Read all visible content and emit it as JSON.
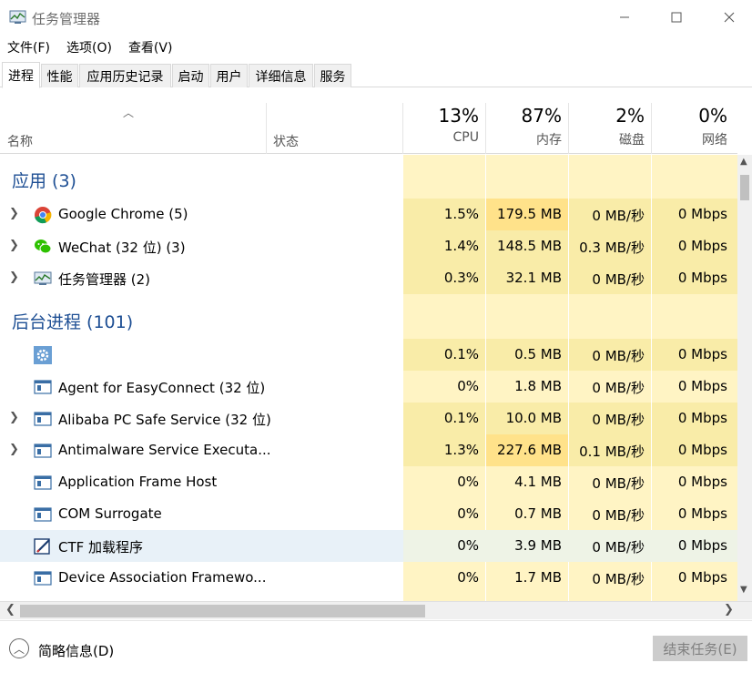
{
  "window": {
    "title": "任务管理器"
  },
  "menu": [
    "文件(F)",
    "选项(O)",
    "查看(V)"
  ],
  "tabs": [
    "进程",
    "性能",
    "应用历史记录",
    "启动",
    "用户",
    "详细信息",
    "服务"
  ],
  "columns": {
    "name": "名称",
    "status": "状态",
    "cpu": {
      "pct": "13%",
      "label": "CPU"
    },
    "memory": {
      "pct": "87%",
      "label": "内存"
    },
    "disk": {
      "pct": "2%",
      "label": "磁盘"
    },
    "network": {
      "pct": "0%",
      "label": "网络"
    }
  },
  "groups": {
    "apps": "应用 (3)",
    "background": "后台进程 (101)"
  },
  "apps": [
    {
      "name": "Google Chrome (5)",
      "icon": "chrome-icon",
      "cpu": "1.5%",
      "mem": "179.5 MB",
      "disk": "0 MB/秒",
      "net": "0 Mbps",
      "expandable": true
    },
    {
      "name": "WeChat (32 位) (3)",
      "icon": "wechat-icon",
      "cpu": "1.4%",
      "mem": "148.5 MB",
      "disk": "0.3 MB/秒",
      "net": "0 Mbps",
      "expandable": true
    },
    {
      "name": "任务管理器 (2)",
      "icon": "task-manager-icon",
      "cpu": "0.3%",
      "mem": "32.1 MB",
      "disk": "0 MB/秒",
      "net": "0 Mbps",
      "expandable": true
    }
  ],
  "background": [
    {
      "name": "",
      "icon": "gear-icon",
      "cpu": "0.1%",
      "mem": "0.5 MB",
      "disk": "0 MB/秒",
      "net": "0 Mbps",
      "expandable": false
    },
    {
      "name": "Agent for EasyConnect (32 位)",
      "icon": "window-icon",
      "cpu": "0%",
      "mem": "1.8 MB",
      "disk": "0 MB/秒",
      "net": "0 Mbps",
      "expandable": false
    },
    {
      "name": "Alibaba PC Safe Service (32 位)",
      "icon": "window-icon",
      "cpu": "0.1%",
      "mem": "10.0 MB",
      "disk": "0 MB/秒",
      "net": "0 Mbps",
      "expandable": true
    },
    {
      "name": "Antimalware Service Executa...",
      "icon": "window-icon",
      "cpu": "1.3%",
      "mem": "227.6 MB",
      "disk": "0.1 MB/秒",
      "net": "0 Mbps",
      "expandable": true
    },
    {
      "name": "Application Frame Host",
      "icon": "window-icon",
      "cpu": "0%",
      "mem": "4.1 MB",
      "disk": "0 MB/秒",
      "net": "0 Mbps",
      "expandable": false
    },
    {
      "name": "COM Surrogate",
      "icon": "window-icon",
      "cpu": "0%",
      "mem": "0.7 MB",
      "disk": "0 MB/秒",
      "net": "0 Mbps",
      "expandable": false
    },
    {
      "name": "CTF 加载程序",
      "icon": "ctf-pen-icon",
      "cpu": "0%",
      "mem": "3.9 MB",
      "disk": "0 MB/秒",
      "net": "0 Mbps",
      "expandable": false,
      "selected": true
    },
    {
      "name": "Device Association Framewo...",
      "icon": "window-icon",
      "cpu": "0%",
      "mem": "1.7 MB",
      "disk": "0 MB/秒",
      "net": "0 Mbps",
      "expandable": false
    }
  ],
  "footer": {
    "fewer_details": "简略信息(D)",
    "end_task": "结束任务(E)"
  },
  "colors": {
    "heat_light": "#fff4c4",
    "heat_mid": "#f9eca8",
    "heat_strong": "#ffd966",
    "group_text": "#1e4f94",
    "selected_row": "#e8f1f8"
  }
}
